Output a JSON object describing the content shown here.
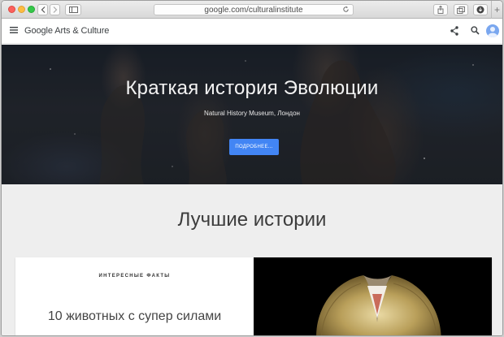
{
  "browser": {
    "url": "google.com/culturalinstitute",
    "new_tab_symbol": "+"
  },
  "header": {
    "brand": "Google Arts & Culture"
  },
  "hero": {
    "title": "Краткая история Эволюции",
    "subtitle": "Natural History Museum, Лондон",
    "button_label": "ПОДРОБНЕЕ..."
  },
  "section": {
    "title": "Лучшие истории"
  },
  "card": {
    "label": "ИНТЕРЕСНЫЕ ФАКТЫ",
    "headline": "10 животных с супер силами",
    "image": "frilled-lizard-photo"
  },
  "colors": {
    "accent": "#4285f4",
    "avatar": "#7aa7ef"
  }
}
